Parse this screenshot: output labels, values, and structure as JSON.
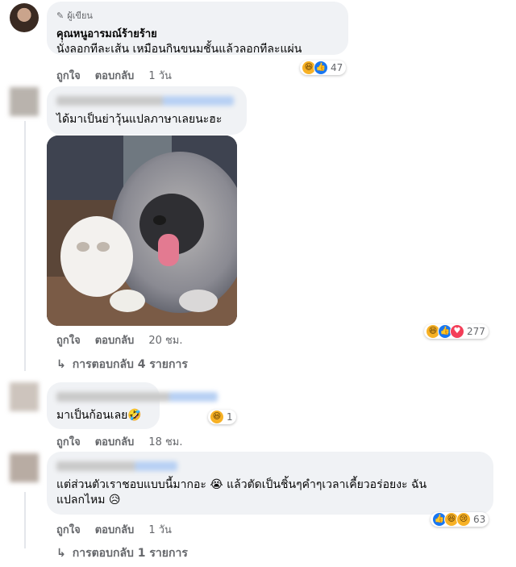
{
  "comments": [
    {
      "author_tag": "ผู้เขียน",
      "author": "คุณหนูอารมณ์ร้ายร้าย",
      "text": "นั่งลอกทีละเส้น เหมือนกินขนมชั้นแล้วลอกทีละแผ่น",
      "reactions": {
        "count": "47",
        "icons": [
          "haha-icon",
          "like-icon"
        ]
      },
      "actions": {
        "like": "ถูกใจ",
        "reply": "ตอบกลับ",
        "time": "1 วัน"
      }
    },
    {
      "author": "",
      "text": "ได้มาเป็นย่าวุ้นแปลภาษาเลยนะฮะ",
      "reactions": {
        "count": "277",
        "icons": [
          "haha-icon",
          "like-icon",
          "love-icon"
        ]
      },
      "actions": {
        "like": "ถูกใจ",
        "reply": "ตอบกลับ",
        "time": "20 ชม."
      },
      "replies_link": "การตอบกลับ 4 รายการ"
    },
    {
      "author": "",
      "text": "มาเป็นก้อนเลย🤣",
      "reactions": {
        "count": "1",
        "icons": [
          "haha-icon"
        ]
      },
      "actions": {
        "like": "ถูกใจ",
        "reply": "ตอบกลับ",
        "time": "18 ชม."
      }
    },
    {
      "author": "",
      "text_line1": "แต่ส่วนตัวเราชอบแบบนี้มากอะ 😭 แล้วตัดเป็นชิ้นๆคำๆเวลาเคี้ยวอร่อยงะ ฉัน",
      "text_line2": "แปลกไหม 😥",
      "reactions": {
        "count": "63",
        "icons": [
          "like-icon",
          "haha-icon",
          "sad-icon"
        ]
      },
      "actions": {
        "like": "ถูกใจ",
        "reply": "ตอบกลับ",
        "time": "1 วัน"
      },
      "replies_link": "การตอบกลับ 1 รายการ"
    }
  ],
  "colors": {
    "bubble": "#f0f2f5",
    "meta": "#65676b",
    "like_blue": "#1877f2",
    "haha_yellow": "#f7b125",
    "love_red": "#f33e58"
  }
}
